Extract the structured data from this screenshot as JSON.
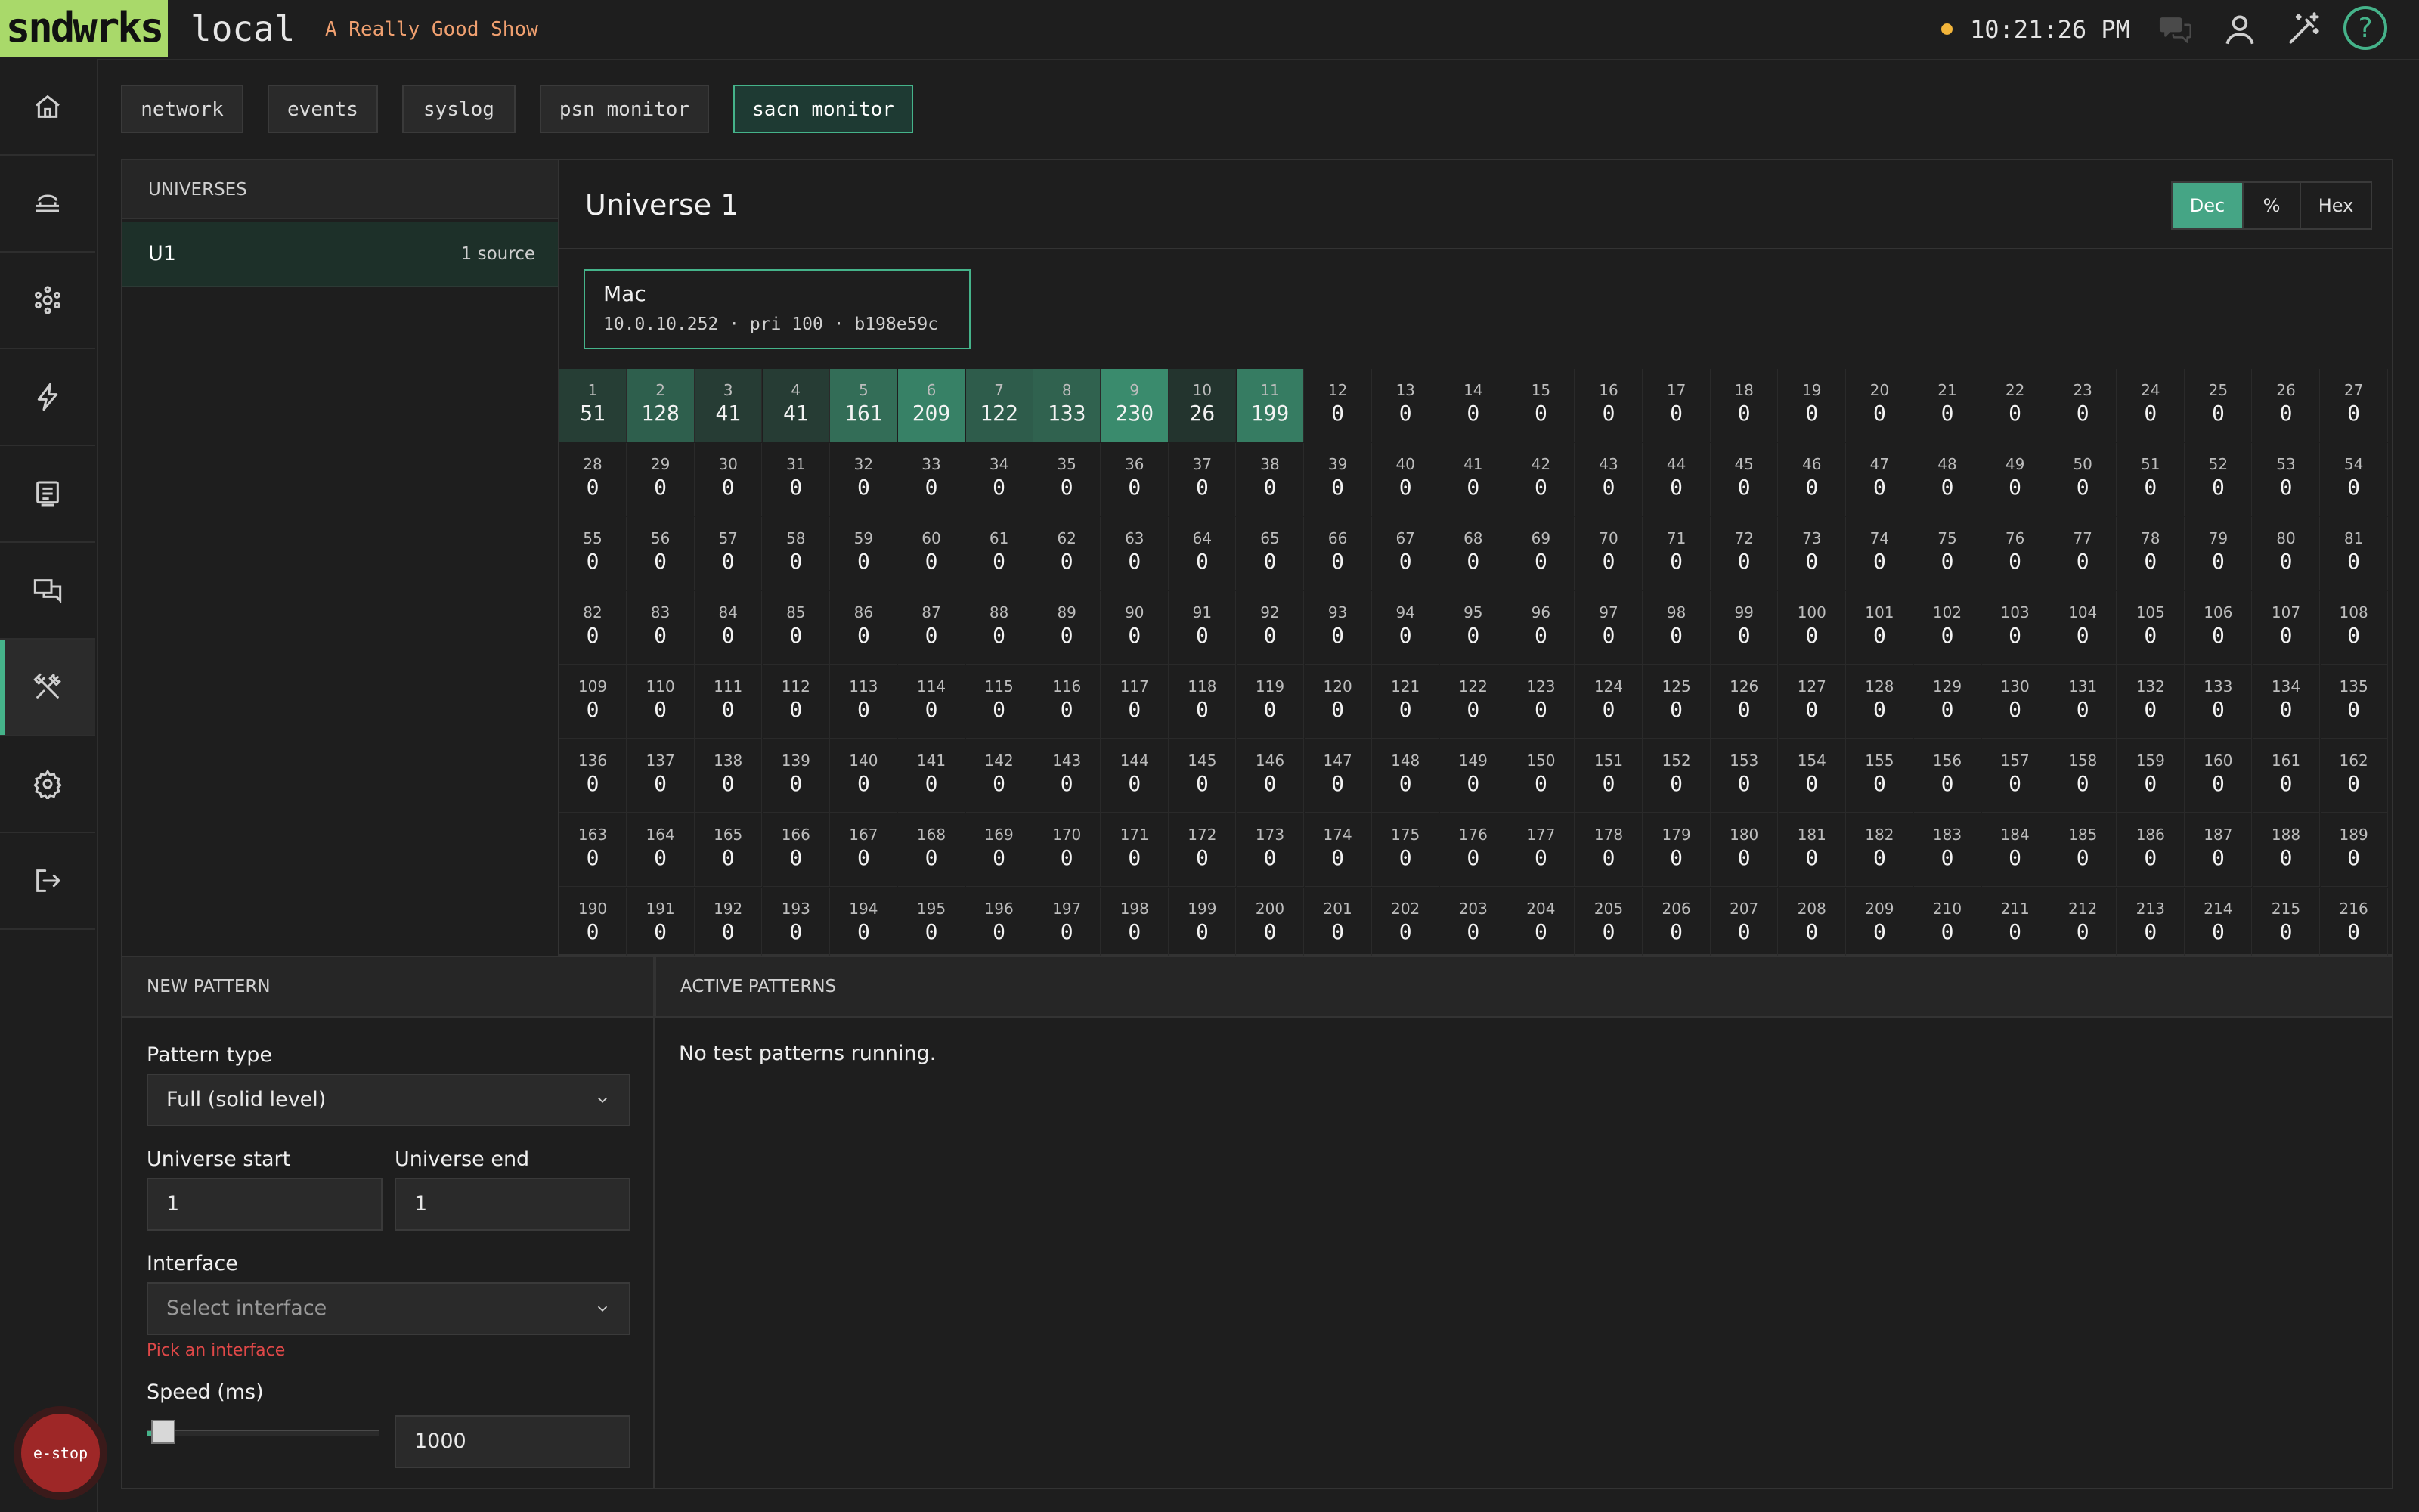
{
  "header": {
    "logo": "sndwrks",
    "site": "local",
    "show": "A Really Good Show",
    "clock": "10:21:26 PM",
    "help_label": "?"
  },
  "nav": {
    "items": [
      "home",
      "network",
      "nodes",
      "power",
      "display",
      "messages",
      "tools",
      "settings",
      "logout"
    ],
    "active": "tools"
  },
  "tabs": [
    {
      "label": "network",
      "active": false
    },
    {
      "label": "events",
      "active": false
    },
    {
      "label": "syslog",
      "active": false
    },
    {
      "label": "psn monitor",
      "active": false
    },
    {
      "label": "sacn monitor",
      "active": true
    }
  ],
  "universes": {
    "heading": "UNIVERSES",
    "items": [
      {
        "name": "U1",
        "sources": "1 source"
      }
    ]
  },
  "universe_view": {
    "title": "Universe 1",
    "formats": [
      {
        "label": "Dec",
        "active": true
      },
      {
        "label": "%",
        "active": false
      },
      {
        "label": "Hex",
        "active": false
      }
    ],
    "source": {
      "name": "Mac",
      "meta": "10.0.10.252 · pri 100 · b198e59c"
    },
    "values": [
      51,
      128,
      41,
      41,
      161,
      209,
      122,
      133,
      230,
      26,
      199
    ],
    "visible_channels": 216
  },
  "new_pattern": {
    "heading": "NEW PATTERN",
    "pattern_type_label": "Pattern type",
    "pattern_type_value": "Full (solid level)",
    "universe_start_label": "Universe start",
    "universe_start_value": "1",
    "universe_end_label": "Universe end",
    "universe_end_value": "1",
    "interface_label": "Interface",
    "interface_placeholder": "Select interface",
    "interface_error": "Pick an interface",
    "speed_label": "Speed (ms)",
    "speed_value": "1000",
    "speed_slider_fraction": 0.02
  },
  "active_patterns": {
    "heading": "ACTIVE PATTERNS",
    "empty_text": "No test patterns running."
  },
  "estop_label": "e-stop",
  "colors": {
    "accent": "#45b38a",
    "logo": "#a9d96a",
    "error": "#e04848",
    "show": "#f0a070"
  }
}
